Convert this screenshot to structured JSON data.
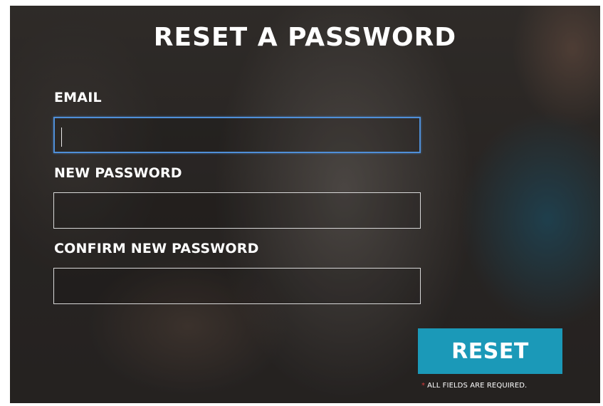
{
  "form": {
    "title": "RESET A PASSWORD",
    "fields": [
      {
        "label": "EMAIL",
        "value": "",
        "placeholder": "",
        "focused": true
      },
      {
        "label": "NEW PASSWORD",
        "value": "",
        "placeholder": "",
        "focused": false
      },
      {
        "label": "CONFIRM NEW PASSWORD",
        "value": "",
        "placeholder": "",
        "focused": false
      }
    ],
    "submit_label": "RESET",
    "required_asterisk": "*",
    "required_note": "ALL FIELDS ARE REQUIRED."
  },
  "colors": {
    "button_background": "#1b99b8",
    "focus_border": "#4f8fd8",
    "asterisk": "#d93c3c",
    "text": "#ffffff"
  }
}
